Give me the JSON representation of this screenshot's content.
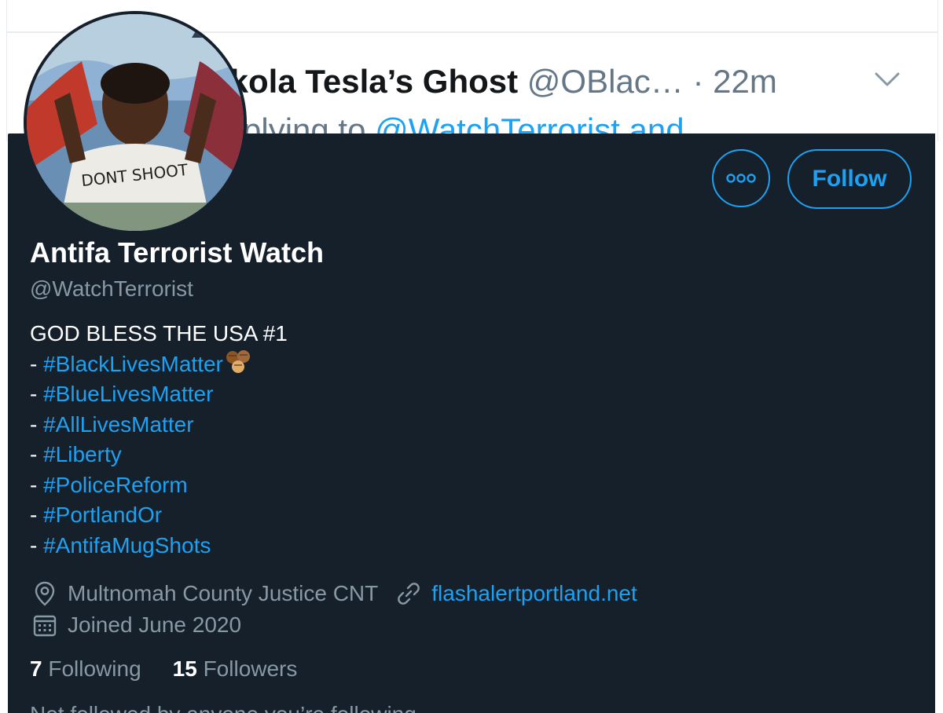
{
  "background_tweet": {
    "name": "ikola Tesla’s Ghost",
    "handle": "@OBlac…",
    "time": "· 22m",
    "replying_prefix": "plying to ",
    "replying_to": "@WatchTerrorist and"
  },
  "card": {
    "display_name": "Antifa Terrorist Watch",
    "handle": "@WatchTerrorist",
    "more_label": "ooo",
    "follow_label": "Follow",
    "bio": {
      "headline": "GOD BLESS THE USA #1",
      "dash": "- ",
      "hashtags": [
        "#BlackLivesMatter",
        "#BlueLivesMatter",
        "#AllLivesMatter",
        "#Liberty",
        "#PoliceReform",
        "#PortlandOr",
        "#AntifaMugShots"
      ]
    },
    "location": "Multnomah County Justice CNT",
    "website": "flashalertportland.net",
    "joined": "Joined June 2020",
    "following_count": "7",
    "following_label": "Following",
    "followers_count": "15",
    "followers_label": "Followers",
    "social_context": "Not followed by anyone you’re following",
    "avatar_shirt_text": "DONT SHOOT"
  },
  "icons": {
    "location": "location-pin-icon",
    "link": "link-icon",
    "calendar": "calendar-icon",
    "more": "more-icon",
    "chevron": "chevron-down-icon",
    "emoji": "raised-fists-emoji"
  },
  "colors": {
    "card_bg": "#15202b",
    "accent": "#1da1f2",
    "secondary_text": "#8899a6",
    "primary_text": "#ffffff"
  }
}
